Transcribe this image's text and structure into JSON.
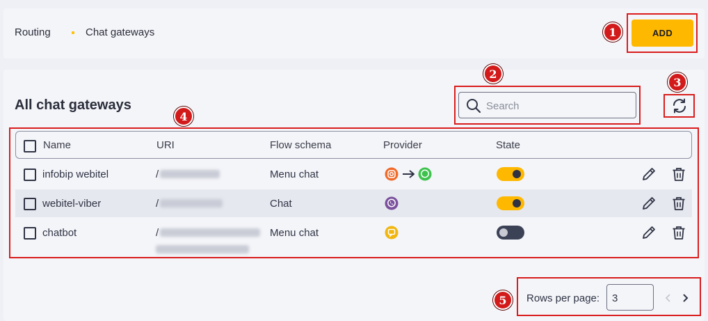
{
  "breadcrumb": {
    "items": [
      "Routing",
      "Chat gateways"
    ]
  },
  "header": {
    "add_label": "ADD"
  },
  "main": {
    "title": "All chat gateways",
    "search_placeholder": "Search"
  },
  "table": {
    "columns": [
      "Name",
      "URI",
      "Flow schema",
      "Provider",
      "State"
    ],
    "rows": [
      {
        "name": "infobip webitel",
        "uri": "/",
        "flow": "Menu chat",
        "provider": [
          "instagram-icon",
          "arrow-right-icon",
          "whatsapp-icon"
        ],
        "state": true
      },
      {
        "name": "webitel-viber",
        "uri": "/",
        "flow": "Chat",
        "provider": [
          "viber-icon"
        ],
        "state": true
      },
      {
        "name": "chatbot",
        "uri": "/",
        "flow": "Menu chat",
        "provider": [
          "webchat-icon"
        ],
        "state": false
      }
    ]
  },
  "pagination": {
    "rows_per_page_label": "Rows per page:",
    "rows_per_page_value": "3"
  },
  "annotations": [
    "1",
    "2",
    "3",
    "4",
    "5"
  ],
  "colors": {
    "accent": "#ffb800",
    "highlight": "#d91c1c",
    "text": "#2f3344"
  }
}
